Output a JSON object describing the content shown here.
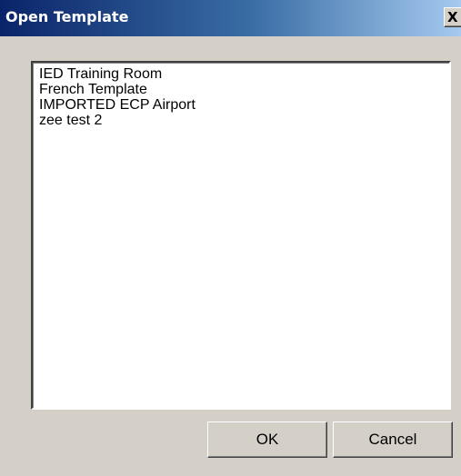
{
  "window": {
    "title": "Open Template",
    "close_glyph": "X"
  },
  "templates": {
    "items": [
      "IED Training Room",
      "French Template",
      "IMPORTED ECP Airport",
      "zee test 2"
    ]
  },
  "buttons": {
    "ok_label": "OK",
    "cancel_label": "Cancel"
  },
  "colors": {
    "titlebar_start": "#0a246a",
    "titlebar_end": "#a6caf0",
    "dialog_face": "#d4d0c8"
  }
}
